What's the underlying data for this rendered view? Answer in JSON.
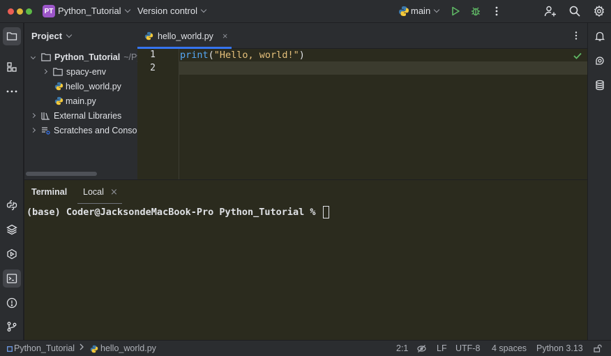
{
  "titlebar": {
    "project_badge": "PT",
    "project_name": "Python_Tutorial",
    "vcs_label": "Version control",
    "branch": "main",
    "colors": {
      "badge": "#9c56c9",
      "run": "#5fb865",
      "debug": "#5fb865"
    }
  },
  "project_panel": {
    "title": "Project",
    "items": [
      {
        "label": "Python_Tutorial",
        "suffix": "~/Py"
      },
      {
        "label": "spacy-env"
      },
      {
        "label": "hello_world.py"
      },
      {
        "label": "main.py"
      },
      {
        "label": "External Libraries"
      },
      {
        "label": "Scratches and Console"
      }
    ]
  },
  "editor": {
    "tab_label": "hello_world.py",
    "tab_close": "×",
    "lines": [
      {
        "num": "1",
        "fn": "print",
        "open": "(",
        "str": "\"Hello, world!\"",
        "close": ")"
      },
      {
        "num": "2"
      }
    ]
  },
  "terminal": {
    "title": "Terminal",
    "tab_label": "Local",
    "tab_close": "×",
    "prompt": "(base) Coder@JacksondeMacBook-Pro Python_Tutorial % "
  },
  "statusbar": {
    "breadcrumb_project": "Python_Tutorial",
    "breadcrumb_file": "hello_world.py",
    "position": "2:1",
    "line_ending": "LF",
    "encoding": "UTF-8",
    "indent": "4 spaces",
    "interpreter": "Python 3.13"
  }
}
